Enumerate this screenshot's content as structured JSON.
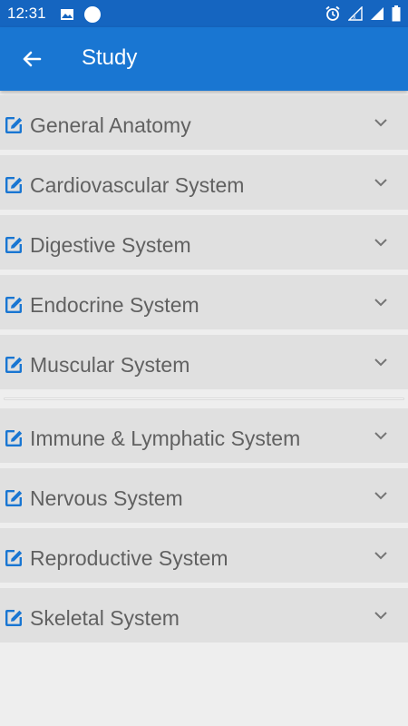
{
  "status_bar": {
    "time": "12:31",
    "left_icons": [
      "image-icon",
      "circle-dot-icon"
    ],
    "right_icons": [
      "alarm-icon",
      "signal-icon",
      "signal-icon",
      "battery-icon"
    ],
    "background": "#1565c0"
  },
  "app_bar": {
    "title": "Study",
    "back_icon": "arrow-back-icon",
    "background": "#1976d2"
  },
  "sections": [
    {
      "label": "General Anatomy"
    },
    {
      "label": "Cardiovascular System"
    },
    {
      "label": "Digestive System"
    },
    {
      "label": "Endocrine System"
    },
    {
      "label": "Muscular System"
    },
    {
      "label": "Immune & Lymphatic System"
    },
    {
      "label": "Nervous System"
    },
    {
      "label": "Reproductive System"
    },
    {
      "label": "Skeletal System"
    }
  ],
  "item_icons": {
    "leading": "edit-icon",
    "trailing": "chevron-down-icon"
  },
  "colors": {
    "accent": "#1976d2",
    "item_background": "#e0e0e0",
    "item_text": "#616161",
    "page_background": "#eeeeee"
  }
}
